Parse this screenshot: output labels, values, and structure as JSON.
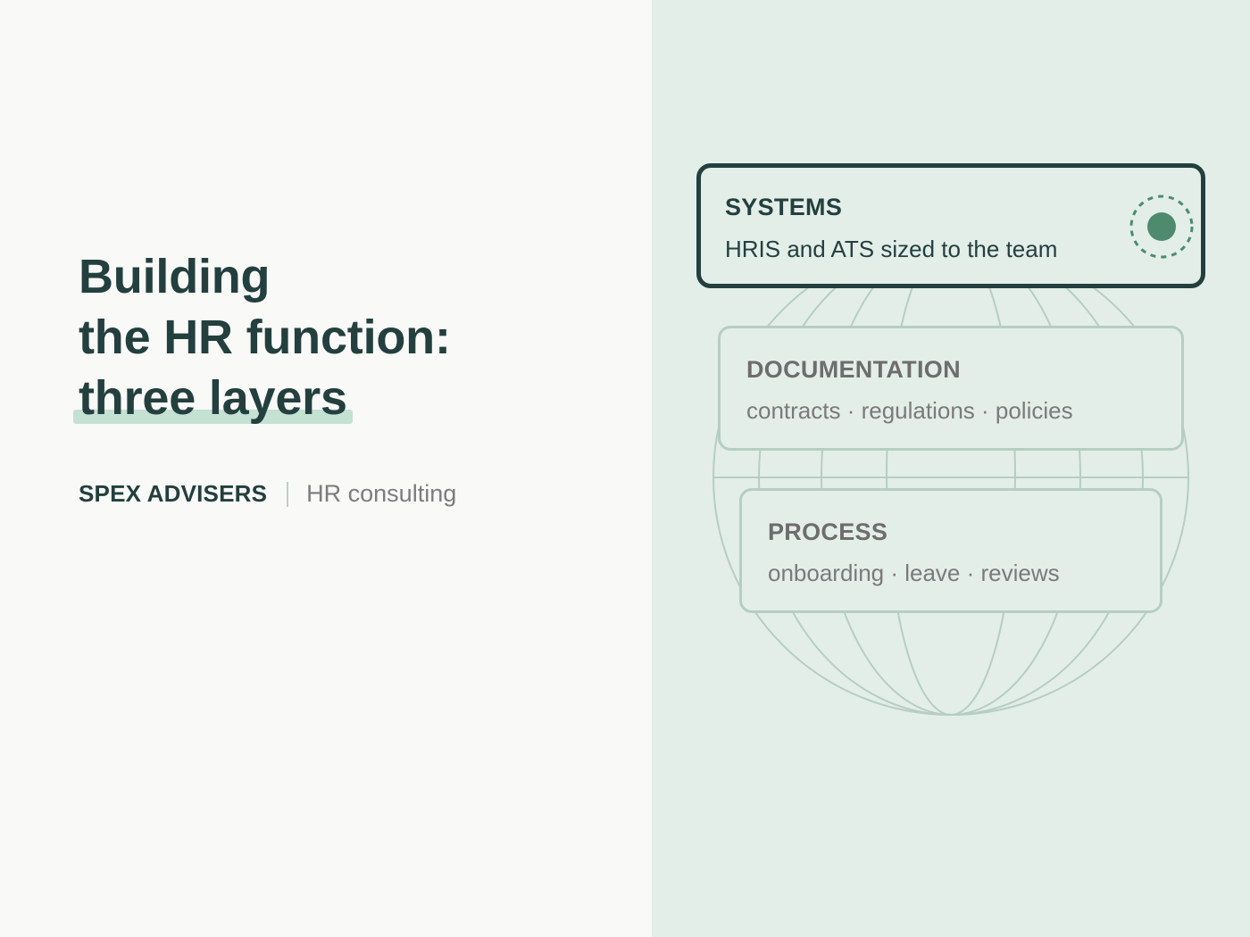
{
  "title": {
    "line1": "Building",
    "line2": "the HR function:",
    "line3": "three layers"
  },
  "brand": {
    "name": "SPEX ADVISERS",
    "tagline": "HR consulting"
  },
  "layers": [
    {
      "title": "SYSTEMS",
      "subtitle": "HRIS and ATS sized to the team",
      "active": true
    },
    {
      "title": "DOCUMENTATION",
      "subtitle": "contracts · regulations · policies",
      "active": false
    },
    {
      "title": "PROCESS",
      "subtitle": "onboarding · leave · reviews",
      "active": false
    }
  ],
  "colors": {
    "ink": "#233f3e",
    "accent": "#4e8a6e",
    "highlight": "#c4e1d3",
    "panel": "#e3eee8",
    "line": "#b6cec2"
  },
  "icons": {
    "indicator": "target-dot-icon",
    "background": "globe-outline"
  }
}
